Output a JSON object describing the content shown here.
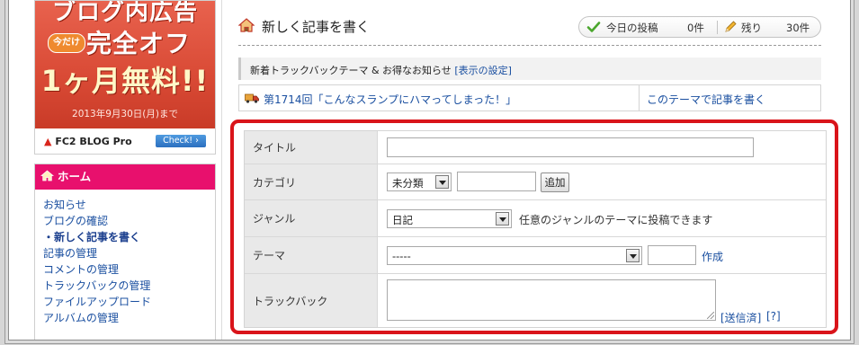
{
  "banner": {
    "line1": "ブログ内広告",
    "badge": "今だけ",
    "line2": "完全オフ",
    "line3": "1ヶ月無料!!",
    "date": "2013年9月30日(月)まで",
    "brand_mark": "ð",
    "brand_name": "FC2 BLOG Pro",
    "check_label": "Check! ›"
  },
  "sidebar": {
    "header": "ホーム",
    "items": [
      {
        "label": "お知らせ"
      },
      {
        "label": "ブログの確認"
      },
      {
        "label": "・新しく記事を書く"
      },
      {
        "label": "記事の管理"
      },
      {
        "label": "コメントの管理"
      },
      {
        "label": "トラックバックの管理"
      },
      {
        "label": "ファイルアップロード"
      },
      {
        "label": "アルバムの管理"
      }
    ]
  },
  "header": {
    "title": "新しく記事を書く",
    "today_label": "今日の投稿",
    "today_value": "0件",
    "remaining_label": "残り",
    "remaining_value": "30件"
  },
  "notice": {
    "text": "新着トラックバックテーマ & お得なお知らせ",
    "link": "[表示の設定]"
  },
  "theme": {
    "title_link": "第1714回「こんなスランプにハマってしまった！」",
    "write_link": "このテーマで記事を書く"
  },
  "form": {
    "title_label": "タイトル",
    "title_value": "",
    "category_label": "カテゴリ",
    "category_value": "未分類",
    "category_new_value": "",
    "add_button": "追加",
    "genre_label": "ジャンル",
    "genre_value": "日記",
    "genre_hint": "任意のジャンルのテーマに投稿できます",
    "theme_label": "テーマ",
    "theme_value": "-----",
    "theme_new_value": "",
    "create_link": "作成",
    "trackback_label": "トラックバック",
    "trackback_value": "",
    "sent_link": "[送信済]",
    "help_link": "[?]"
  },
  "colors": {
    "accent_pink": "#e8106d",
    "highlight_red": "#d9141a",
    "link_blue": "#1a4fa0"
  },
  "icons": [
    "home-icon",
    "checkmark-icon",
    "pencil-icon",
    "truck-icon",
    "dropdown-arrow-icon"
  ]
}
